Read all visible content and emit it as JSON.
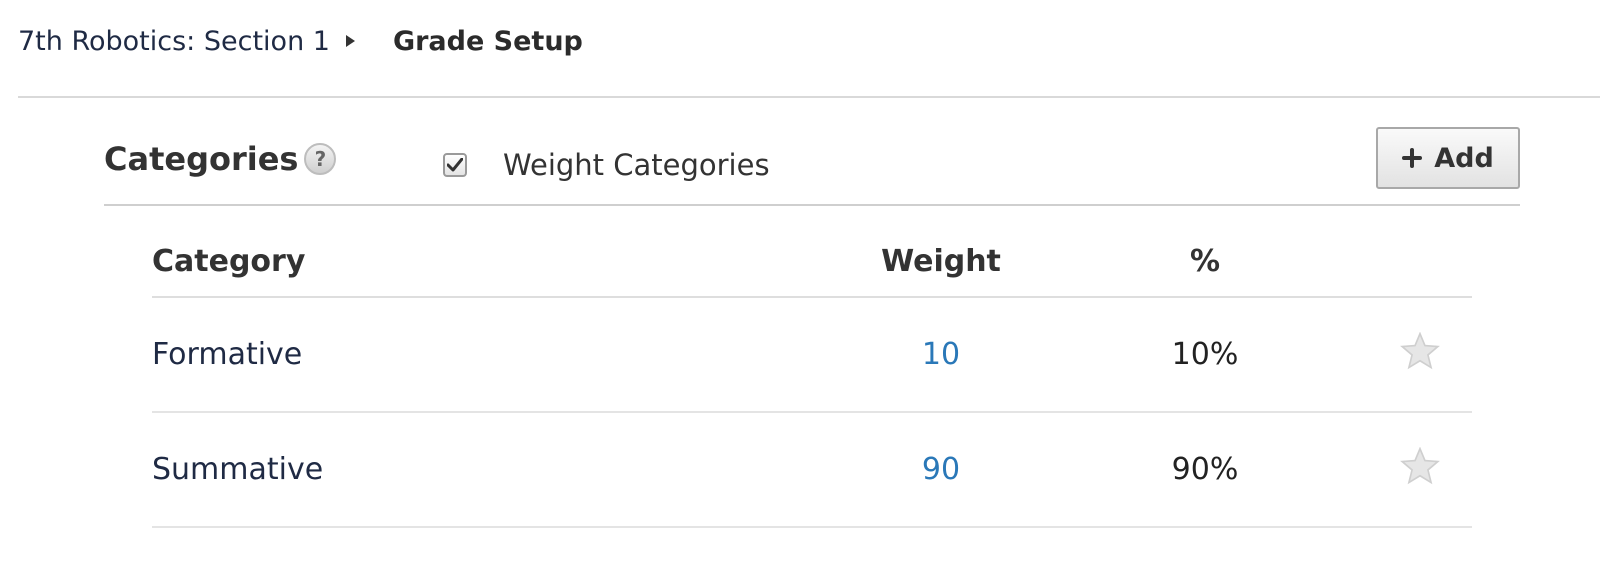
{
  "breadcrumb": {
    "section": "7th Robotics: Section 1",
    "current": "Grade Setup"
  },
  "categories": {
    "title": "Categories",
    "help": "?",
    "weight_toggle_label": "Weight Categories",
    "weight_checked": true,
    "add_label": "Add",
    "add_icon": "plus-icon"
  },
  "table": {
    "headers": {
      "category": "Category",
      "weight": "Weight",
      "percent": "%"
    },
    "rows": [
      {
        "category": "Formative",
        "weight": "10",
        "percent": "10%",
        "star_icon": "star-icon"
      },
      {
        "category": "Summative",
        "weight": "90",
        "percent": "90%",
        "star_icon": "star-icon"
      }
    ]
  },
  "colors": {
    "link_blue": "#2a78b8",
    "star_gray": "#d6d6d6"
  }
}
